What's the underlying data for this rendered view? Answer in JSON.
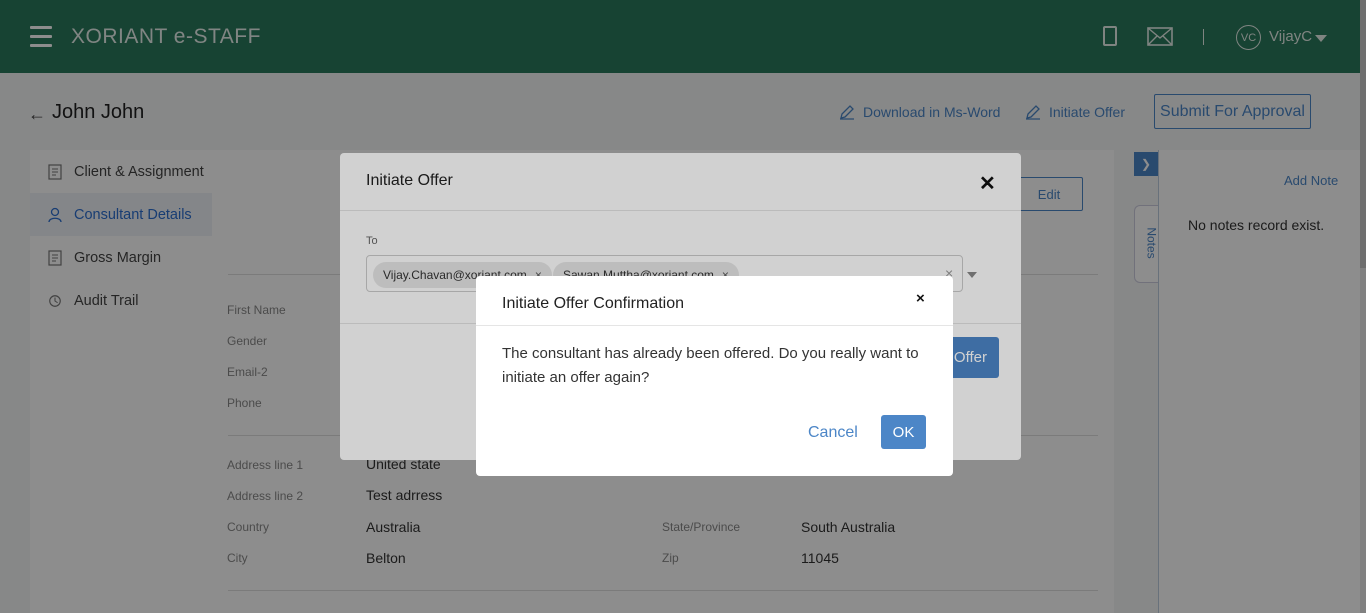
{
  "app": {
    "title": "XORIANT e-STAFF"
  },
  "topbar": {
    "avatar_initials": "VC",
    "user_name": "VijayC"
  },
  "header": {
    "page_title": "John John",
    "download_label": "Download in Ms-Word",
    "initiate_label": "Initiate Offer",
    "submit_label": "Submit For Approval"
  },
  "sidebar": {
    "items": [
      {
        "label": "Client & Assignment",
        "icon": "document-icon"
      },
      {
        "label": "Consultant Details",
        "icon": "user-icon",
        "active": true
      },
      {
        "label": "Gross Margin",
        "icon": "document-icon"
      },
      {
        "label": "Audit Trail",
        "icon": "history-icon"
      }
    ]
  },
  "main": {
    "edit_label": "Edit",
    "fields": {
      "first_name_label": "First Name",
      "gender_label": "Gender",
      "email2_label": "Email-2",
      "phone_label": "Phone",
      "address1_label": "Address line 1",
      "address1_value": "United state",
      "address2_label": "Address line 2",
      "address2_value": "Test adrress",
      "country_label": "Country",
      "country_value": "Australia",
      "state_label": "State/Province",
      "state_value": "South Australia",
      "city_label": "City",
      "city_value": "Belton",
      "zip_label": "Zip",
      "zip_value": "11045"
    }
  },
  "notes": {
    "tab_label": "Notes",
    "add_label": "Add Note",
    "empty_text": "No notes record exist."
  },
  "offer_modal": {
    "title": "Initiate Offer",
    "to_label": "To",
    "recipients": [
      "Vijay.Chavan@xoriant.com",
      "Sawan.Muttha@xoriant.com"
    ],
    "offer_button": "Offer"
  },
  "confirm_dialog": {
    "title": "Initiate Offer Confirmation",
    "message": "The consultant has already been offered. Do you really want to initiate an offer again?",
    "cancel_label": "Cancel",
    "ok_label": "OK"
  },
  "colors": {
    "topbar": "#2b7a5e",
    "accent": "#4c86c7"
  }
}
